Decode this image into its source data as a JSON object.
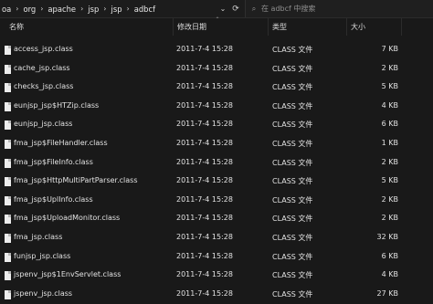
{
  "breadcrumb": [
    "oa",
    "org",
    "apache",
    "jsp",
    "jsp",
    "adbcf"
  ],
  "search": {
    "placeholder": "在 adbcf 中搜索"
  },
  "columns": {
    "name": "名称",
    "date": "修改日期",
    "type": "类型",
    "size": "大小"
  },
  "files": [
    {
      "name": "access_jsp.class",
      "date": "2011-7-4 15:28",
      "type": "CLASS 文件",
      "size": "7 KB"
    },
    {
      "name": "cache_jsp.class",
      "date": "2011-7-4 15:28",
      "type": "CLASS 文件",
      "size": "2 KB"
    },
    {
      "name": "checks_jsp.class",
      "date": "2011-7-4 15:28",
      "type": "CLASS 文件",
      "size": "5 KB"
    },
    {
      "name": "eunjsp_jsp$HTZip.class",
      "date": "2011-7-4 15:28",
      "type": "CLASS 文件",
      "size": "4 KB"
    },
    {
      "name": "eunjsp_jsp.class",
      "date": "2011-7-4 15:28",
      "type": "CLASS 文件",
      "size": "6 KB"
    },
    {
      "name": "fma_jsp$FileHandler.class",
      "date": "2011-7-4 15:28",
      "type": "CLASS 文件",
      "size": "1 KB"
    },
    {
      "name": "fma_jsp$FileInfo.class",
      "date": "2011-7-4 15:28",
      "type": "CLASS 文件",
      "size": "2 KB"
    },
    {
      "name": "fma_jsp$HttpMultiPartParser.class",
      "date": "2011-7-4 15:28",
      "type": "CLASS 文件",
      "size": "5 KB"
    },
    {
      "name": "fma_jsp$UplInfo.class",
      "date": "2011-7-4 15:28",
      "type": "CLASS 文件",
      "size": "2 KB"
    },
    {
      "name": "fma_jsp$UploadMonitor.class",
      "date": "2011-7-4 15:28",
      "type": "CLASS 文件",
      "size": "2 KB"
    },
    {
      "name": "fma_jsp.class",
      "date": "2011-7-4 15:28",
      "type": "CLASS 文件",
      "size": "32 KB"
    },
    {
      "name": "funjsp_jsp.class",
      "date": "2011-7-4 15:28",
      "type": "CLASS 文件",
      "size": "6 KB"
    },
    {
      "name": "jspenv_jsp$1EnvServlet.class",
      "date": "2011-7-4 15:28",
      "type": "CLASS 文件",
      "size": "4 KB"
    },
    {
      "name": "jspenv_jsp.class",
      "date": "2011-7-4 15:28",
      "type": "CLASS 文件",
      "size": "27 KB"
    }
  ]
}
